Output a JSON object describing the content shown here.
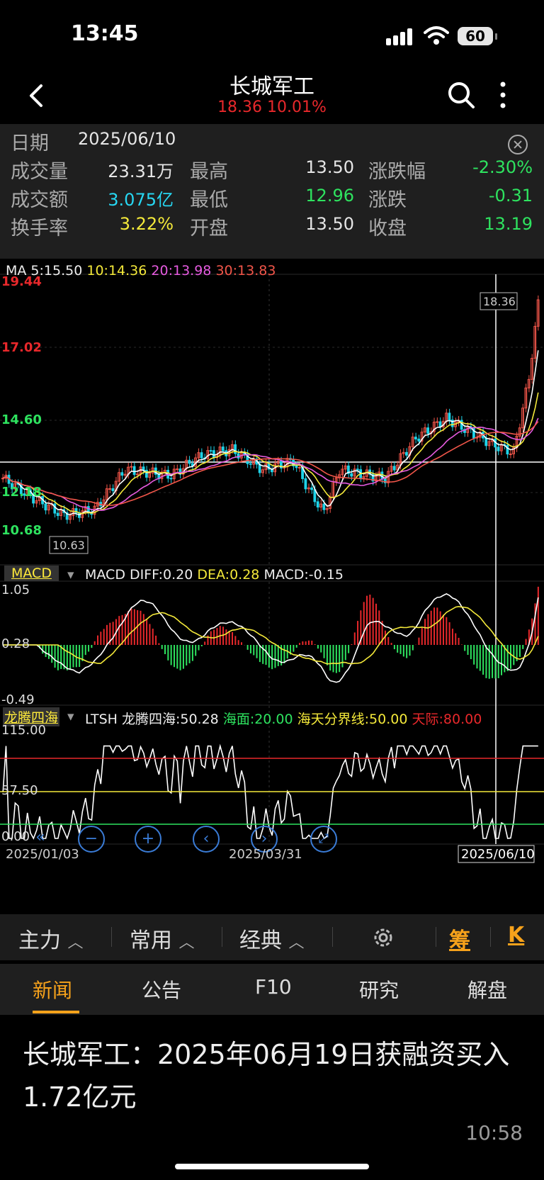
{
  "status": {
    "time": "13:45",
    "battery": "60"
  },
  "nav": {
    "title": "长城军工",
    "subtitle": "18.36 10.01%"
  },
  "info": {
    "date_label": "日期",
    "date_value": "2025/06/10",
    "rows": [
      [
        {
          "label": "成交量",
          "value": "23.31万",
          "color": "#e6e6e6"
        },
        {
          "label": "最高",
          "value": "13.50",
          "color": "#e6e6e6"
        },
        {
          "label": "涨跌幅",
          "value": "-2.30%",
          "color": "#2ee35f"
        }
      ],
      [
        {
          "label": "成交额",
          "value": "3.075亿",
          "color": "#27d7f2"
        },
        {
          "label": "最低",
          "value": "12.96",
          "color": "#2ee35f"
        },
        {
          "label": "涨跌",
          "value": "-0.31",
          "color": "#2ee35f"
        }
      ],
      [
        {
          "label": "换手率",
          "value": "3.22%",
          "color": "#f4e93a"
        },
        {
          "label": "开盘",
          "value": "13.50",
          "color": "#e6e6e6"
        },
        {
          "label": "收盘",
          "value": "13.19",
          "color": "#2ee35f"
        }
      ]
    ]
  },
  "chart": {
    "ma": {
      "ma5": "MA 5:15.50",
      "ma10": "10:14.36",
      "ma20": "20:13.98",
      "ma30": "30:13.83"
    },
    "price_labels": [
      "19.44",
      "17.02",
      "14.60",
      "12.18",
      "10.68"
    ],
    "last_price_tag": "18.36",
    "low_price_tag": "10.63",
    "macd": {
      "tag": "MACD",
      "title": "MACD DIFF:0.20",
      "dea": "DEA:0.28",
      "macd": "MACD:-0.15",
      "axis": [
        "1.05",
        "0.28",
        "-0.49"
      ]
    },
    "ltsh": {
      "tag": "龙腾四海",
      "title": "LTSH 龙腾四海:50.28",
      "haimian": "海面:20.00",
      "haitian": "海天分界线:50.00",
      "tianji": "天际:80.00",
      "axis": [
        "115.00",
        "57.50",
        "0.00"
      ]
    },
    "dates": [
      "2025/01/03",
      "2025/03/31",
      "2025/06/10"
    ]
  },
  "chart_data": {
    "type": "candlestick",
    "price_axis": [
      10.68,
      19.44
    ],
    "moving_averages": {
      "MA5": 15.5,
      "MA10": 14.36,
      "MA20": 13.98,
      "MA30": 13.83
    },
    "last_close": 18.36,
    "macd": {
      "DIFF": 0.2,
      "DEA": 0.28,
      "MACD": -0.15
    },
    "ltsh": {
      "value": 50.28,
      "haimian": 20.0,
      "haitian": 50.0,
      "tianji": 80.0
    },
    "x_labels": [
      "2025/01/03",
      "2025/03/31",
      "2025/06/10"
    ]
  },
  "toolbar": {
    "zhuli": "主力",
    "changyong": "常用",
    "jingdian": "经典",
    "chou": "筹",
    "k": "K"
  },
  "tabs": [
    "新闻",
    "公告",
    "F10",
    "研究",
    "解盘"
  ],
  "news": {
    "title": "长城军工：2025年06月19日获融资买入1.72亿元",
    "time": "10:58"
  }
}
